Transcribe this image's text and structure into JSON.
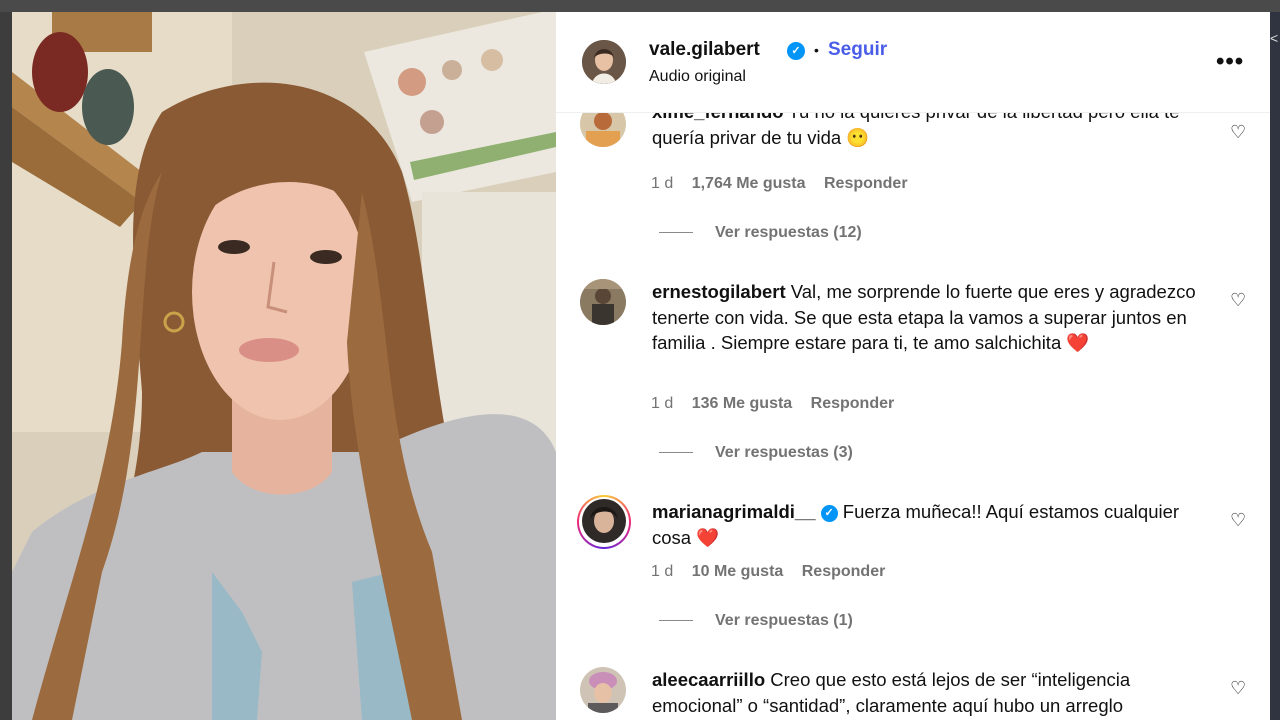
{
  "post": {
    "username": "vale.gilabert",
    "follow_label": "Seguir",
    "separator": "•",
    "audio": "Audio original",
    "more_label": "•••"
  },
  "icons": {
    "verified": "verified-badge-icon",
    "heart": "heart-outline-icon",
    "more": "more-options-icon"
  },
  "colors": {
    "accent": "#4a5de8",
    "verified": "#0095f6",
    "muted": "#737373",
    "heart_emoji": "#e0243b"
  },
  "comments": [
    {
      "username": "xime_fernando",
      "text": "Tu no la quieres privar de la libertad pero ella te quería privar de tu vida 😶",
      "time": "1 d",
      "likes": "1,764 Me gusta",
      "reply": "Responder",
      "replies": "Ver respuestas (12)"
    },
    {
      "username": "ernestogilabert",
      "text": "Val, me sorprende lo fuerte que eres y agradezco tenerte con vida. Se que esta etapa la vamos a superar juntos en familia . Siempre estare para ti, te amo salchichita ❤️",
      "time": "1 d",
      "likes": "136 Me gusta",
      "reply": "Responder",
      "replies": "Ver respuestas (3)"
    },
    {
      "username": "marianagrimaldi__",
      "verified": "✓",
      "text": "Fuerza muñeca!! Aquí estamos cualquier cosa ❤️",
      "time": "1 d",
      "likes": "10 Me gusta",
      "reply": "Responder",
      "replies": "Ver respuestas (1)"
    },
    {
      "username": "aleecaarriillo",
      "text": "Creo que esto está lejos de ser “inteligencia emocional” o “santidad”, claramente aquí hubo un arreglo económico; quien en su sano juicio otorgaría el perdón a"
    }
  ],
  "verified_mark": "✓",
  "heart_glyph": "♡",
  "close_glyph": "<"
}
